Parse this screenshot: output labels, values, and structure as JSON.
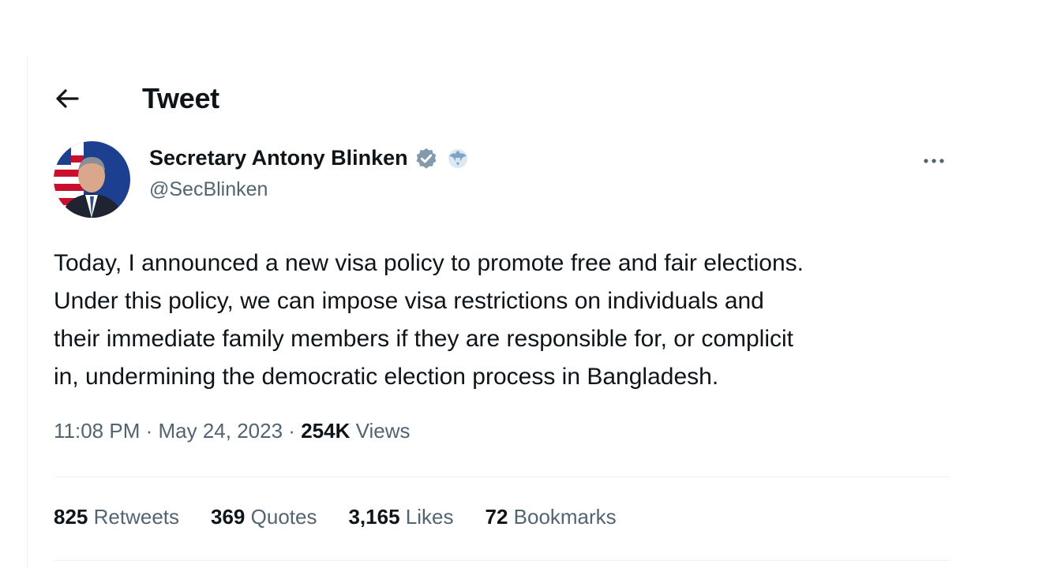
{
  "header": {
    "title": "Tweet",
    "back_icon": "arrow-left-icon"
  },
  "author": {
    "display_name": "Secretary Antony Blinken",
    "handle": "@SecBlinken",
    "verified_icon": "verified-badge-icon",
    "affiliation_icon": "state-department-seal-icon",
    "more_icon": "more-options-icon"
  },
  "tweet": {
    "lines": [
      "Today, I announced a new visa policy to promote free and fair elections.",
      "Under this policy, we can impose visa restrictions on individuals and",
      "their immediate family members if they are responsible for, or complicit",
      "in, undermining the democratic election process in Bangladesh."
    ]
  },
  "meta": {
    "time": "11:08 PM",
    "date": "May 24, 2023",
    "views_count": "254K",
    "views_label": "Views",
    "separator": "·"
  },
  "stats": [
    {
      "count": "825",
      "label": "Retweets"
    },
    {
      "count": "369",
      "label": "Quotes"
    },
    {
      "count": "3,165",
      "label": "Likes"
    },
    {
      "count": "72",
      "label": "Bookmarks"
    }
  ],
  "colors": {
    "text": "#0f1419",
    "secondary": "#536471",
    "divider": "#eff3f4",
    "verified": "#829aab"
  }
}
